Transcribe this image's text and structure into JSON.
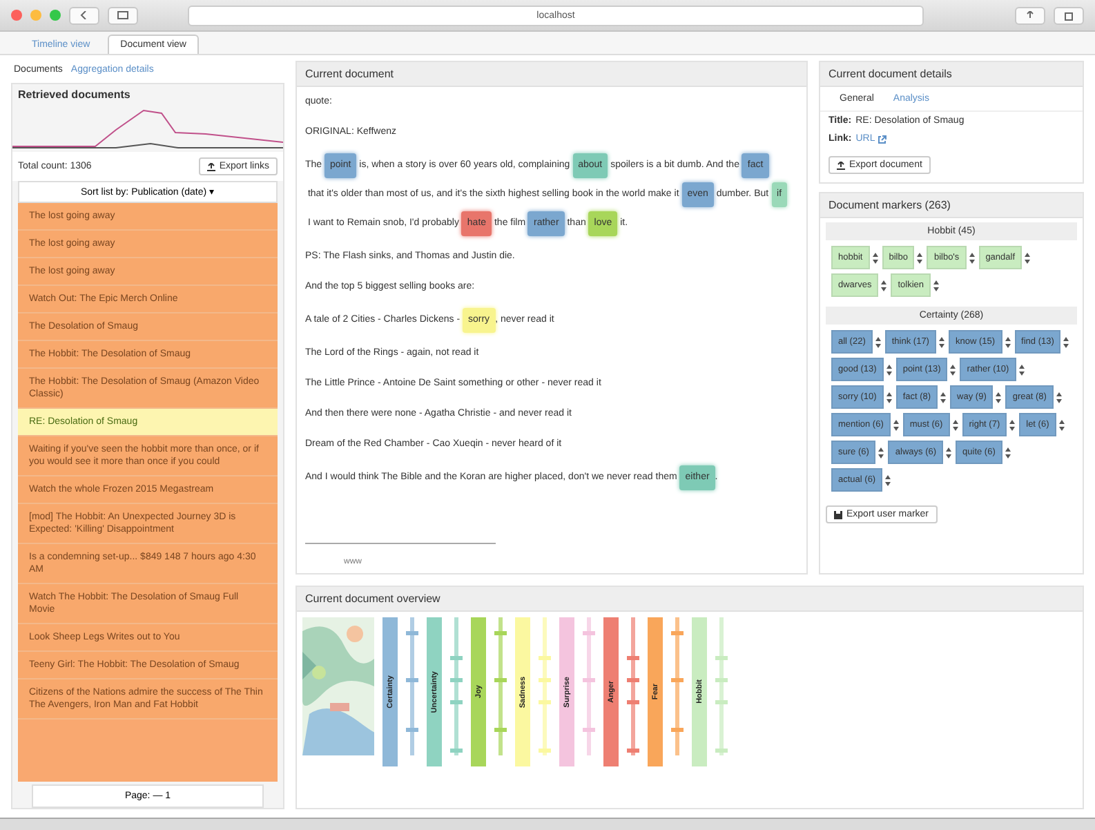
{
  "browser": {
    "address": "localhost",
    "tabs": [
      {
        "label": "Timeline view",
        "selected": false
      },
      {
        "label": "Document view",
        "selected": true
      }
    ]
  },
  "left": {
    "tabs": [
      {
        "label": "Documents",
        "selected": true
      },
      {
        "label": "Aggregation details",
        "selected": false
      }
    ],
    "title": "Retrieved documents",
    "count": "Total count: 1306",
    "export": "Export links",
    "sort": "Sort list by: Publication (date) ▾",
    "page": "Page: — 1",
    "items": [
      {
        "title": "The lost going away",
        "selected": false
      },
      {
        "title": "The lost going away",
        "selected": false
      },
      {
        "title": "The lost going away",
        "selected": false
      },
      {
        "title": "Watch Out: The Epic Merch Online",
        "selected": false
      },
      {
        "title": "The Desolation of Smaug",
        "selected": false
      },
      {
        "title": "The Hobbit: The Desolation of Smaug",
        "selected": false
      },
      {
        "title": "The Hobbit: The Desolation of Smaug (Amazon Video Classic)",
        "selected": false
      },
      {
        "title": "RE: Desolation of Smaug",
        "selected": true
      },
      {
        "title": "Waiting if you've seen the hobbit more than once, or if you would see it more than once if you could",
        "selected": false
      },
      {
        "title": "Watch the whole Frozen 2015 Megastream",
        "selected": false
      },
      {
        "title": "[mod] The Hobbit: An Unexpected Journey 3D is Expected: 'Killing' Disappointment",
        "selected": false
      },
      {
        "title": "Is a condemning set-up... $849 148 7 hours ago 4:30 AM",
        "selected": false
      },
      {
        "title": "Watch The Hobbit: The Desolation of Smaug Full Movie",
        "selected": false
      },
      {
        "title": "Look Sheep Legs Writes out to You",
        "selected": false
      },
      {
        "title": "Teeny Girl: The Hobbit: The Desolation of Smaug",
        "selected": false
      },
      {
        "title": "Citizens of the Nations admire the success of The Thin The Avengers, Iron Man and Fat Hobbit",
        "selected": false
      }
    ]
  },
  "document": {
    "title": "Current document",
    "paragraphs": [
      {
        "segments": [
          {
            "text": "quote:"
          }
        ]
      },
      {
        "segments": [
          {
            "text": "ORIGINAL: Keffwenz"
          }
        ]
      },
      {
        "segments": [
          {
            "text": "The "
          },
          {
            "text": "point",
            "color": "#7ba7cf"
          },
          {
            "text": " is, when a story is over 60 years old, complaining "
          },
          {
            "text": "about",
            "color": "#7ecab5"
          },
          {
            "text": " spoilers is a bit dumb. And the "
          },
          {
            "text": "fact",
            "color": "#7ba7cf"
          },
          {
            "text": " that it's older than most of us, and it's the sixth highest selling book in the world make it "
          },
          {
            "text": "even",
            "color": "#7ba7cf"
          },
          {
            "text": " dumber. But "
          },
          {
            "text": "if",
            "color": "#9ad9b8"
          },
          {
            "text": " I want to Remain snob, I'd probably "
          },
          {
            "text": "hate",
            "color": "#e8756b"
          },
          {
            "text": " the film "
          },
          {
            "text": "rather",
            "color": "#7ba7cf"
          },
          {
            "text": " than "
          },
          {
            "text": "love",
            "color": "#a8d65a"
          },
          {
            "text": " it."
          }
        ]
      },
      {
        "segments": [
          {
            "text": "PS: The Flash sinks, and Thomas and Justin die."
          }
        ]
      },
      {
        "segments": [
          {
            "text": "And the top 5 biggest selling books are:"
          }
        ]
      },
      {
        "segments": [
          {
            "text": "A tale of 2 Cities - Charles Dickens - "
          },
          {
            "text": "sorry",
            "color": "#f8f48e"
          },
          {
            "text": ", never read it"
          }
        ]
      },
      {
        "segments": [
          {
            "text": "The Lord of the Rings - again, not read it"
          }
        ]
      },
      {
        "segments": [
          {
            "text": "The Little Prince - Antoine De Saint something or other - never read it"
          }
        ]
      },
      {
        "segments": [
          {
            "text": "And then there were none - Agatha Christie - and never read it"
          }
        ]
      },
      {
        "segments": [
          {
            "text": "Dream of the Red Chamber - Cao Xueqin - never heard of it"
          }
        ]
      },
      {
        "segments": [
          {
            "text": "And I would think The Bible and the Koran are higher placed, don't we never read them "
          },
          {
            "text": "either",
            "color": "#7ecab5"
          },
          {
            "text": "."
          }
        ]
      }
    ],
    "signature": "www"
  },
  "details": {
    "title": "Current document details",
    "tabs": [
      {
        "label": "General",
        "selected": true
      },
      {
        "label": "Analysis",
        "selected": false
      }
    ],
    "title_label": "Title:",
    "title_value": "RE: Desolation of Smaug",
    "link_label": "Link:",
    "link_value": "URL",
    "export": "Export document"
  },
  "markers": {
    "title": "Document markers (263)",
    "export": "Export user marker",
    "groups": [
      {
        "name": "Hobbit (45)",
        "color": "#c9ecc0",
        "tags": [
          "hobbit",
          "bilbo",
          "bilbo's",
          "gandalf",
          "dwarves",
          "tolkien"
        ]
      },
      {
        "name": "Certainty (268)",
        "color": "#7ba7cf",
        "tags": [
          "all (22)",
          "think (17)",
          "know (15)",
          "find (13)",
          "good (13)",
          "point (13)",
          "rather (10)",
          "sorry (10)",
          "fact (8)",
          "way (9)",
          "great (8)",
          "mention (6)",
          "must (6)",
          "right (7)",
          "let (6)",
          "sure (6)",
          "always (6)",
          "quite (6)",
          "actual (6)"
        ]
      }
    ]
  },
  "overview": {
    "title": "Current document overview",
    "columns": [
      {
        "label": "Certainty",
        "color": "#8fb8d8"
      },
      {
        "label": "Uncertainty",
        "color": "#8fd3c1"
      },
      {
        "label": "Joy",
        "color": "#a8d65a"
      },
      {
        "label": "Sadness",
        "color": "#fbf8a0"
      },
      {
        "label": "Surprise",
        "color": "#f4c4de"
      },
      {
        "label": "Anger",
        "color": "#ee7f72"
      },
      {
        "label": "Fear",
        "color": "#f9a65a"
      },
      {
        "label": "Hobbit",
        "color": "#c9ecc0"
      }
    ]
  }
}
